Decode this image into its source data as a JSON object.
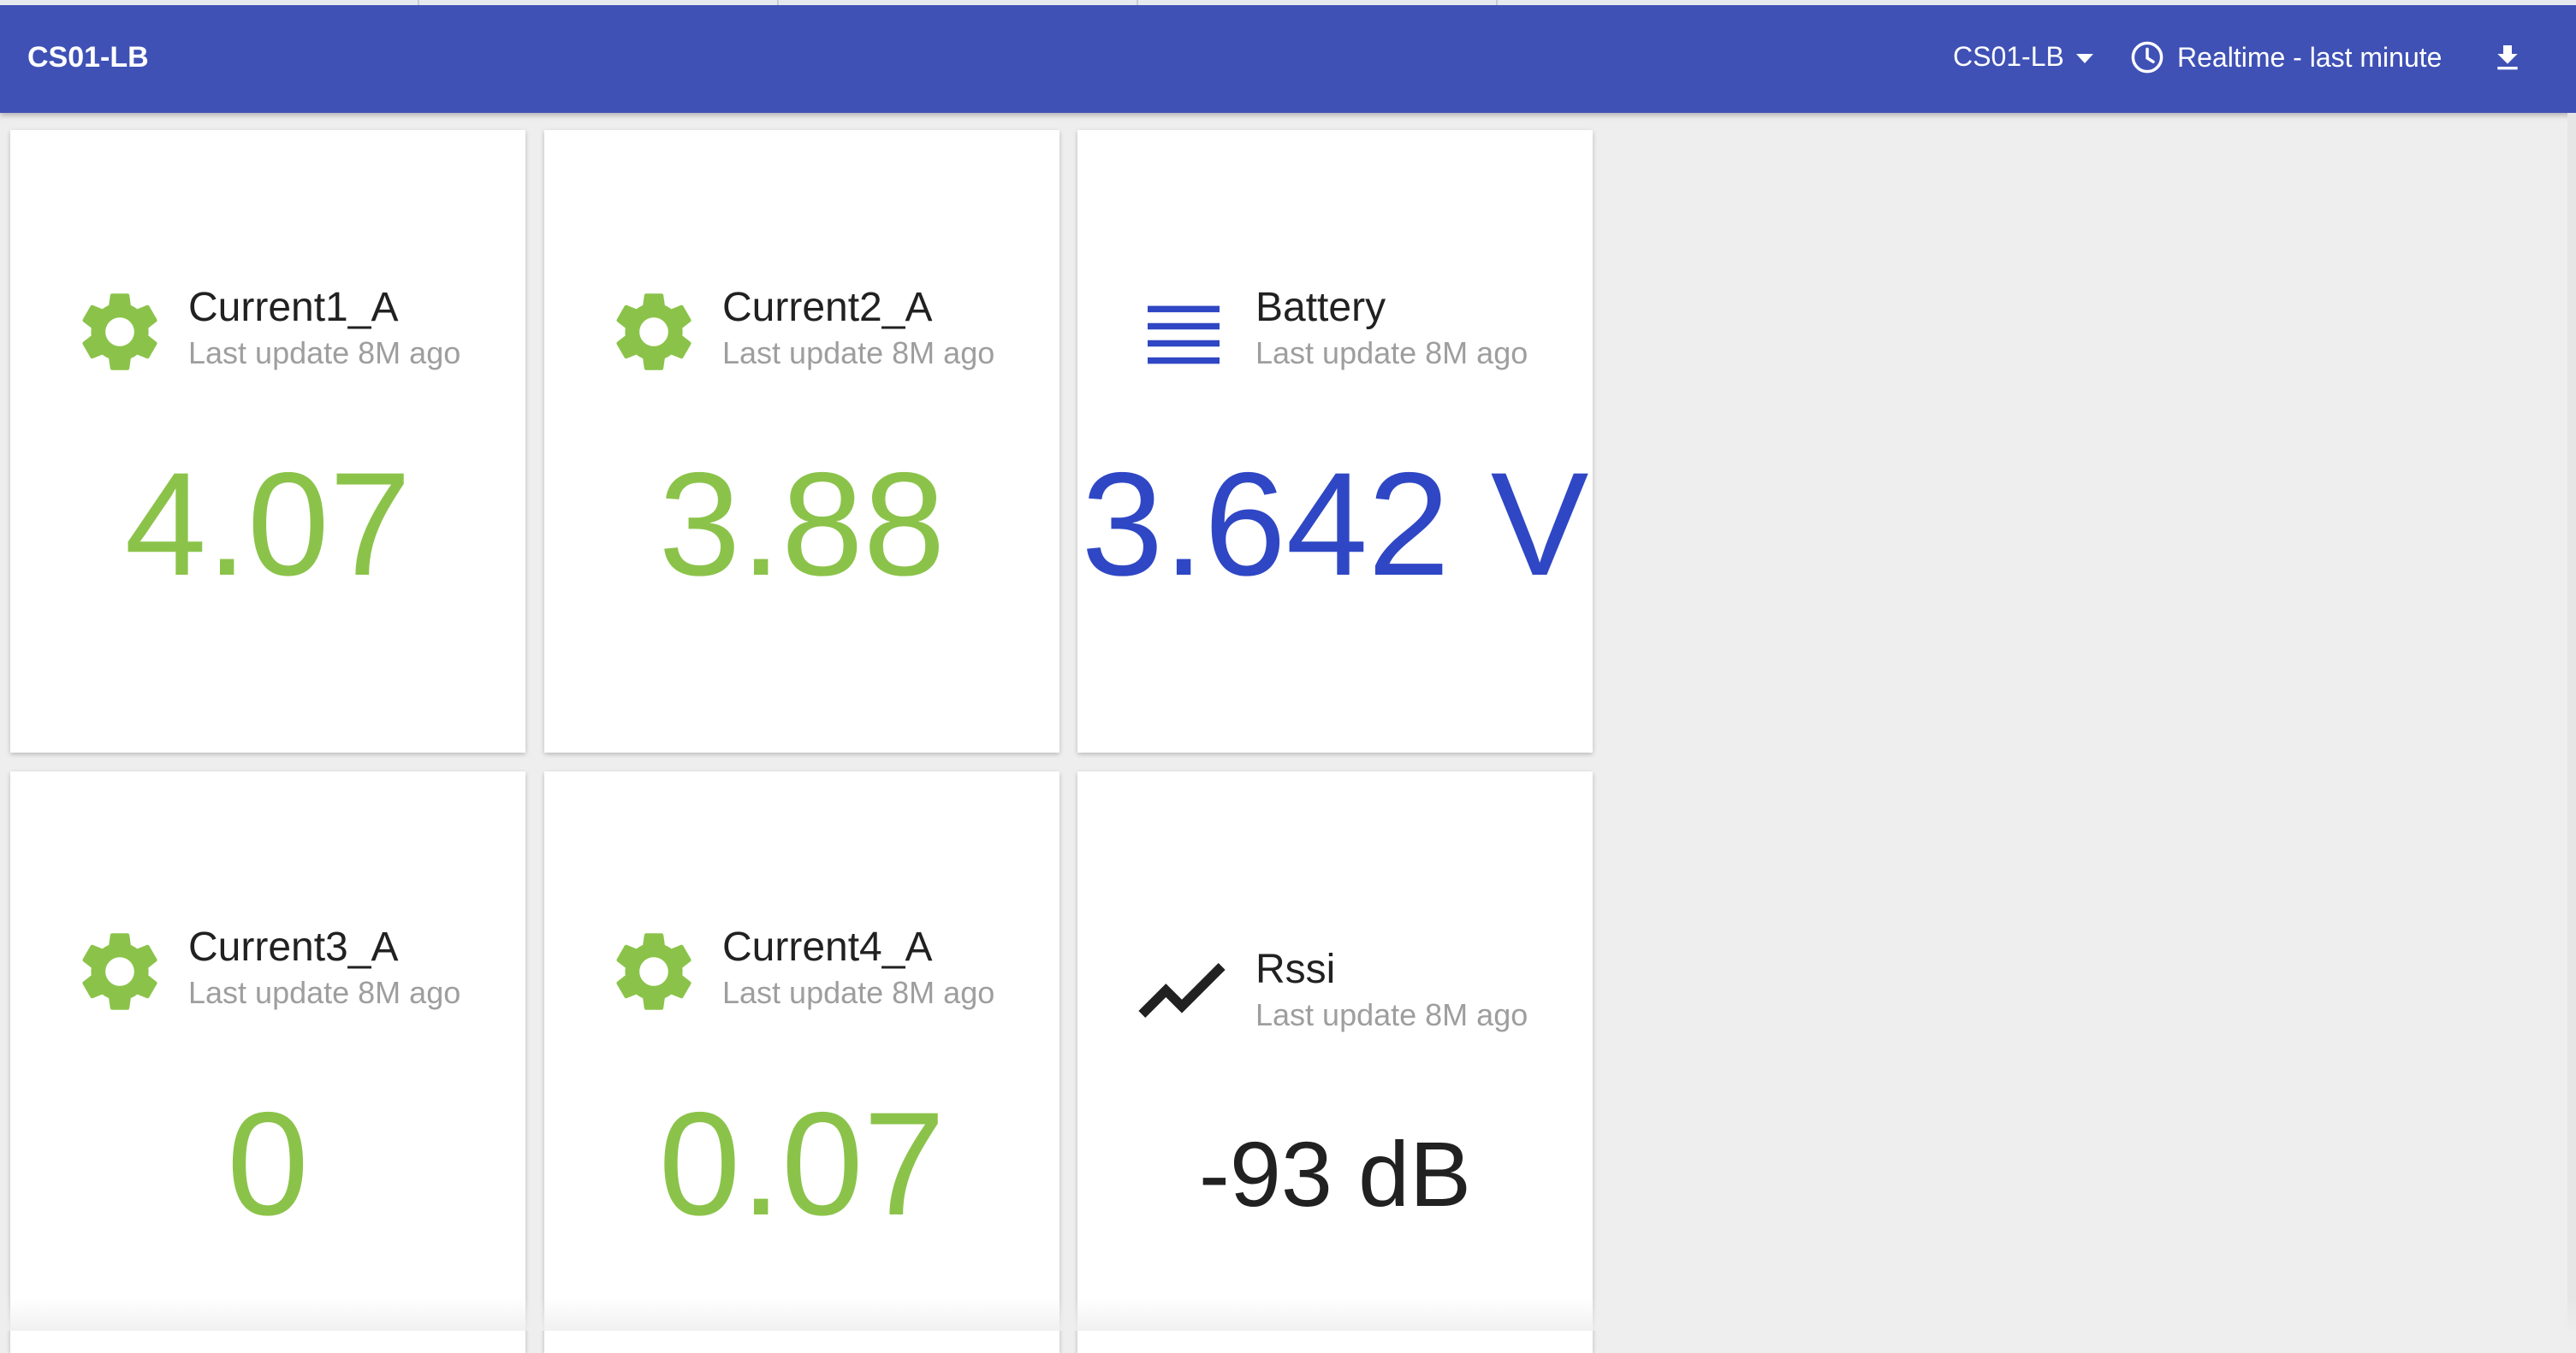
{
  "header": {
    "title": "CS01-LB",
    "device_selector": "CS01-LB",
    "time_range": "Realtime - last minute",
    "background": "#3f51b5",
    "icons": {
      "device": "chevron-down-icon",
      "time": "clock-icon",
      "download": "download-icon"
    }
  },
  "cards": [
    {
      "title": "Current1_A",
      "subtitle": "Last update 8M ago",
      "value": "4.07",
      "icon": "gear-icon",
      "color": "#8bc34a"
    },
    {
      "title": "Current2_A",
      "subtitle": "Last update 8M ago",
      "value": "3.88",
      "icon": "gear-icon",
      "color": "#8bc34a"
    },
    {
      "title": "Battery",
      "subtitle": "Last update 8M ago",
      "value": "3.642 V",
      "icon": "menu-lines-icon",
      "color": "#2f47c4"
    },
    {
      "title": "Current3_A",
      "subtitle": "Last update 8M ago",
      "value": "0",
      "icon": "gear-icon",
      "color": "#8bc34a"
    },
    {
      "title": "Current4_A",
      "subtitle": "Last update 8M ago",
      "value": "0.07",
      "icon": "gear-icon",
      "color": "#8bc34a"
    },
    {
      "title": "Rssi",
      "subtitle": "Last update 8M ago",
      "value": "-93 dB",
      "icon": "signal-trend-icon",
      "color": "#212121"
    }
  ]
}
